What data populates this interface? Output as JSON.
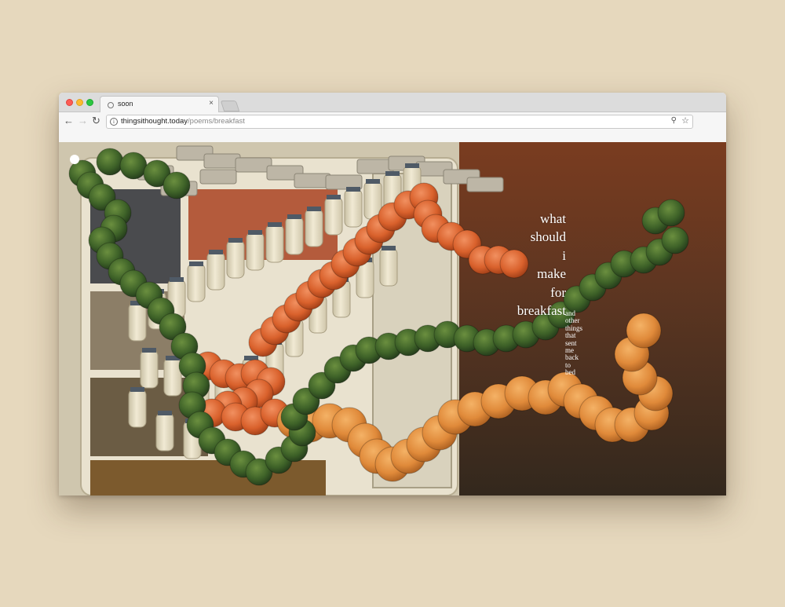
{
  "browser": {
    "tab_title": "soon",
    "close_glyph": "×",
    "url_host": "thingsithought.today",
    "url_path": "/poems/breakfast",
    "nav": {
      "back": "←",
      "forward": "→",
      "reload": "↻"
    },
    "icons": {
      "info": "info-icon",
      "zoom": "zoom-icon",
      "star": "star-icon",
      "info_glyph": "i",
      "zoom_glyph": "⚲",
      "star_glyph": "☆"
    }
  },
  "poem": {
    "title_lines": [
      "what",
      "should",
      "i",
      "make",
      "for",
      "breakfast"
    ],
    "subtitle_lines": [
      "and",
      "other",
      "things",
      "that",
      "sent",
      "me",
      "back",
      "to",
      "bed"
    ]
  },
  "colors": {
    "page_background": "#e6d8bd",
    "artichoke": "#3e6228",
    "tomato": "#d9612c",
    "orange": "#e08a3a",
    "milk_bottle": "#ece4cc",
    "fridge": "#e9e2cf",
    "wall": "#6e3a22"
  }
}
